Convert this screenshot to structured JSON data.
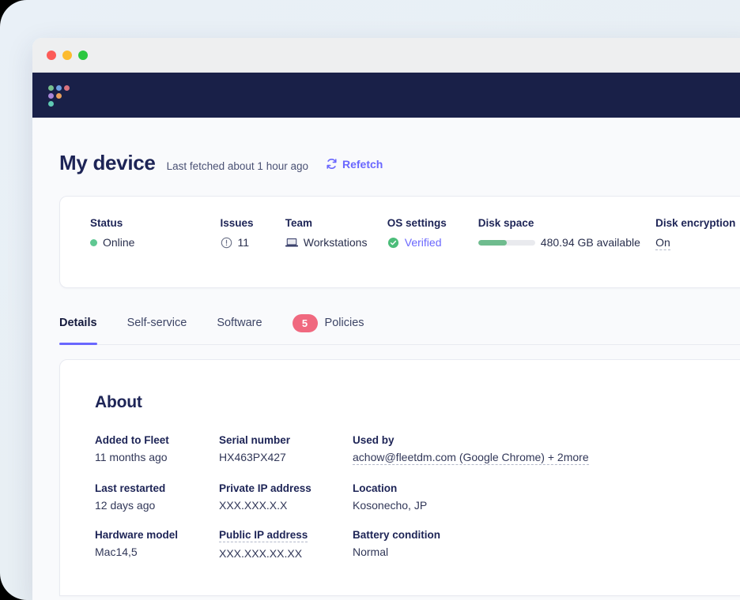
{
  "window": {
    "traffic_lights": [
      "close",
      "minimize",
      "maximize"
    ]
  },
  "topbar": {
    "logo_name": "fleet-logo",
    "logo_dots": [
      "#76bf8f",
      "#6c9fe0",
      "#d9737f",
      "#a987d9",
      "#e8a05c",
      "#5fc9b4"
    ]
  },
  "header": {
    "title": "My device",
    "last_fetched": "Last fetched about 1 hour ago",
    "refetch_label": "Refetch",
    "refetch_icon": "refresh-icon"
  },
  "summary": {
    "status": {
      "label": "Status",
      "value": "Online",
      "icon": "status-dot-online",
      "color": "#5fc892"
    },
    "issues": {
      "label": "Issues",
      "value": "11",
      "icon": "alert-circle-icon"
    },
    "team": {
      "label": "Team",
      "value": "Workstations",
      "icon": "laptop-icon"
    },
    "os_settings": {
      "label": "OS settings",
      "value": "Verified",
      "icon": "check-circle-icon",
      "color": "#6a67fe"
    },
    "disk_space": {
      "label": "Disk space",
      "value": "480.94 GB available",
      "bar_percent": 50,
      "bar_color": "#6fbc8e"
    },
    "disk_encryption": {
      "label": "Disk encryption",
      "value": "On"
    }
  },
  "tabs": [
    {
      "label": "Details",
      "active": true,
      "badge": null
    },
    {
      "label": "Self-service",
      "active": false,
      "badge": null
    },
    {
      "label": "Software",
      "active": false,
      "badge": null
    },
    {
      "label": "Policies",
      "active": false,
      "badge": "5"
    }
  ],
  "tab_badge_color": "#f0697f",
  "accent_color": "#6a67fe",
  "about": {
    "title": "About",
    "fields": [
      {
        "label": "Added to Fleet",
        "value": "11 months ago",
        "label_dotted": false,
        "value_dotted": false
      },
      {
        "label": "Serial number",
        "value": "HX463PX427",
        "label_dotted": false,
        "value_dotted": false
      },
      {
        "label": "Used by",
        "value": "achow@fleetdm.com (Google Chrome) + 2more",
        "label_dotted": false,
        "value_dotted": true
      },
      {
        "label": "Last restarted",
        "value": "12 days ago",
        "label_dotted": false,
        "value_dotted": false
      },
      {
        "label": "Private IP address",
        "value": "XXX.XXX.X.X",
        "label_dotted": false,
        "value_dotted": false
      },
      {
        "label": "Location",
        "value": "Kosonecho, JP",
        "label_dotted": false,
        "value_dotted": false
      },
      {
        "label": "Hardware model",
        "value": "Mac14,5",
        "label_dotted": false,
        "value_dotted": false
      },
      {
        "label": "Public IP address",
        "value": "XXX.XXX.XX.XX",
        "label_dotted": true,
        "value_dotted": false
      },
      {
        "label": "Battery condition",
        "value": "Normal",
        "label_dotted": false,
        "value_dotted": false
      }
    ]
  }
}
